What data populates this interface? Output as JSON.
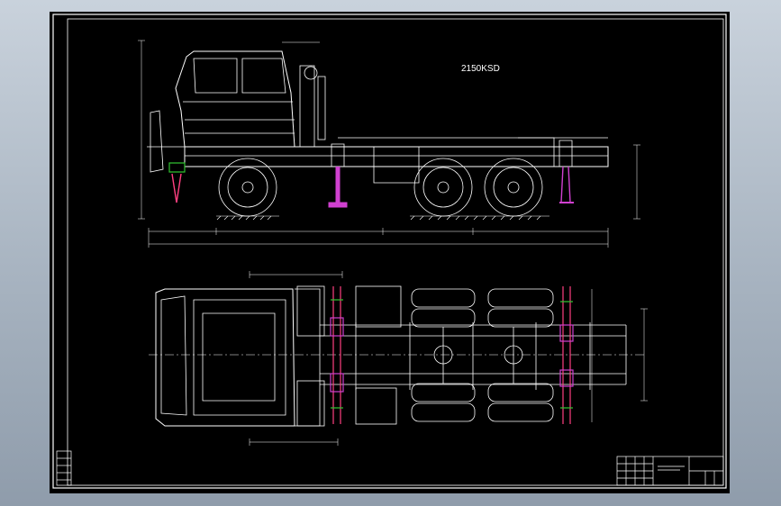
{
  "drawing": {
    "title": "2150KSD",
    "colors": {
      "background": "#000000",
      "line": "#ffffff",
      "jack": "#d040d0",
      "jack_head": "#ff4080",
      "support": "#30c030",
      "viewport": "#9aa6b4"
    }
  }
}
